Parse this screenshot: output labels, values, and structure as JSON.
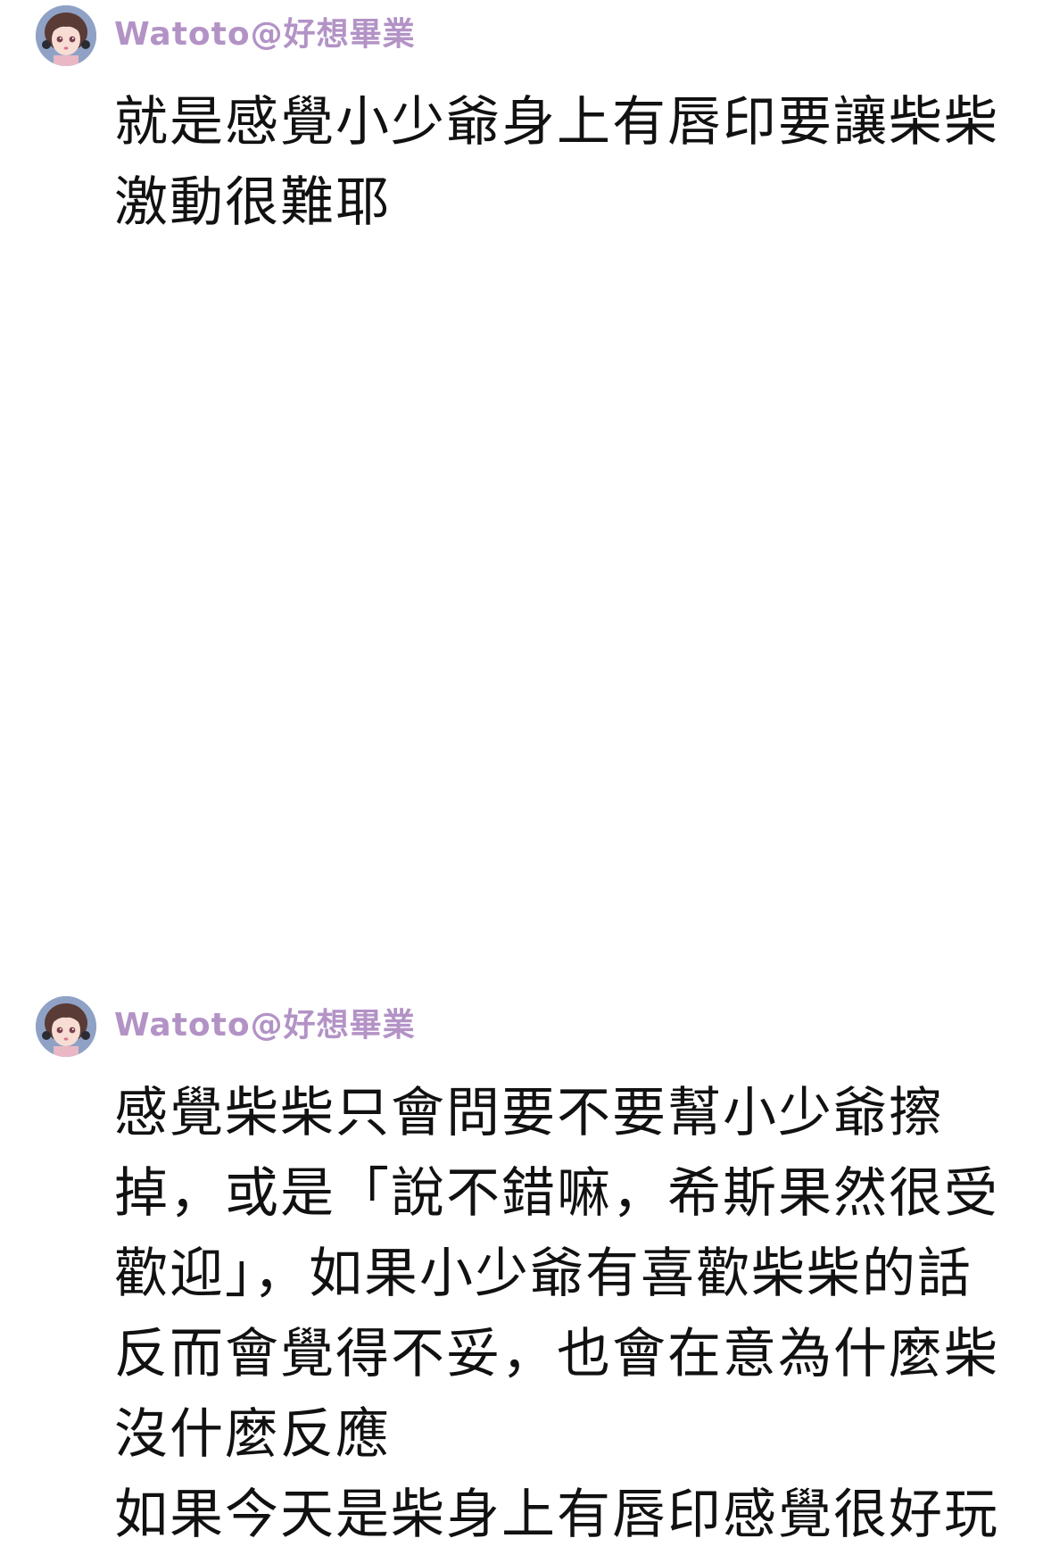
{
  "comments": [
    {
      "username": "Watoto@好想畢業",
      "avatar_icon": "girl-avatar-icon",
      "lines": [
        "就是感覺小少爺身上有唇印要讓柴柴",
        "激動很難耶"
      ]
    },
    {
      "username": "Watoto@好想畢業",
      "avatar_icon": "girl-avatar-icon",
      "lines": [
        "感覺柴柴只會問要不要幫小少爺擦",
        "掉，或是「說不錯嘛，希斯果然很受",
        "歡迎」，如果小少爺有喜歡柴柴的話",
        "反而會覺得不妥，也會在意為什麼柴",
        "沒什麼反應",
        "如果今天是柴身上有唇印感覺很好玩"
      ]
    }
  ],
  "colors": {
    "username": "#b393c6",
    "text": "#111111",
    "background": "#ffffff"
  }
}
